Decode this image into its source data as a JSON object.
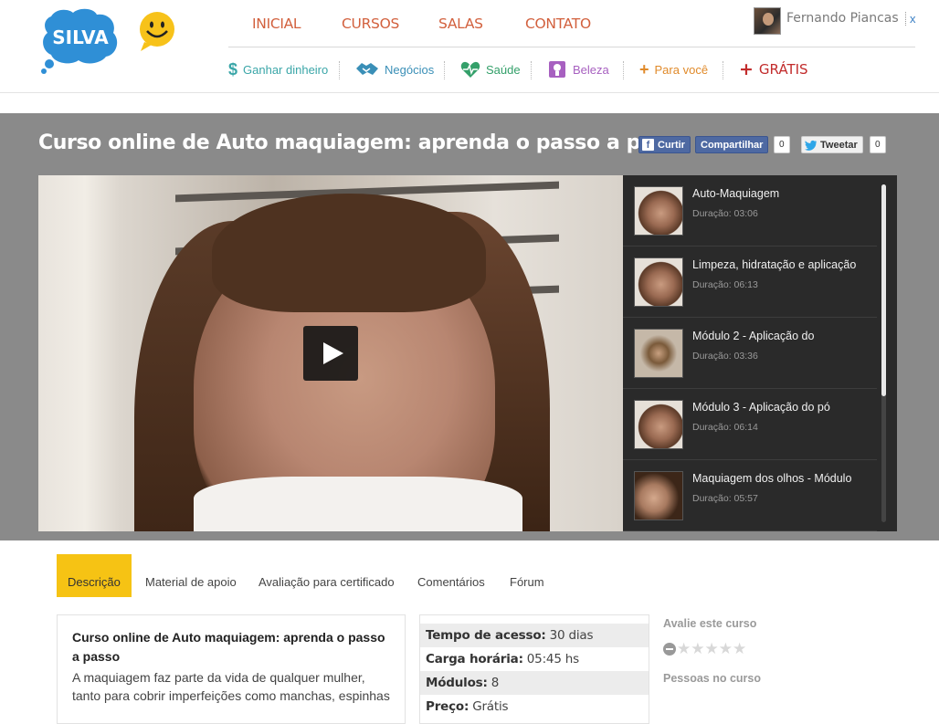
{
  "brand": {
    "logo_text": "SILVA"
  },
  "nav": {
    "main": [
      "INICIAL",
      "CURSOS",
      "SALAS",
      "CONTATO"
    ],
    "sub": [
      {
        "label": "Ganhar dinheiro",
        "icon": "dollar-icon",
        "color": "#3aa6a8"
      },
      {
        "label": "Negócios",
        "icon": "handshake-icon",
        "color": "#3a8fb7"
      },
      {
        "label": "Saúde",
        "icon": "heart-pulse-icon",
        "color": "#34a06a"
      },
      {
        "label": "Beleza",
        "icon": "mirror-icon",
        "color": "#a760c0"
      },
      {
        "label": "Para você",
        "icon": "plus-icon",
        "color": "#e08a2a"
      },
      {
        "label": "GRÁTIS",
        "icon": "plus-icon",
        "color": "#c22c2c"
      }
    ]
  },
  "user": {
    "name": "Fernando Piancas",
    "close": "x"
  },
  "course": {
    "title": "Curso online de Auto maquiagem: aprenda o passo a passo"
  },
  "social": {
    "like_label": "Curtir",
    "share_label": "Compartilhar",
    "share_count": "0",
    "tweet_label": "Tweetar",
    "tweet_count": "0"
  },
  "playlist": [
    {
      "title": "Auto-Maquiagem",
      "duration": "Duração: 03:06"
    },
    {
      "title": "Limpeza, hidratação e aplicação",
      "duration": "Duração: 06:13"
    },
    {
      "title": "Módulo 2 - Aplicação do",
      "duration": "Duração: 03:36"
    },
    {
      "title": "Módulo 3 - Aplicação do pó",
      "duration": "Duração: 06:14"
    },
    {
      "title": "Maquiagem dos olhos - Módulo",
      "duration": "Duração: 05:57"
    }
  ],
  "tabs": [
    "Descrição",
    "Material de apoio",
    "Avaliação para certificado",
    "Comentários",
    "Fórum"
  ],
  "description": {
    "title": "Curso online de Auto maquiagem: aprenda o passo a passo",
    "text": "A maquiagem faz parte da vida de qualquer mulher, tanto para cobrir imperfeições como manchas, espinhas"
  },
  "info": [
    {
      "label": "Tempo de acesso:",
      "value": "30 dias"
    },
    {
      "label": "Carga horária:",
      "value": "05:45 hs"
    },
    {
      "label": "Módulos:",
      "value": "8"
    },
    {
      "label": "Preço:",
      "value": "Grátis"
    }
  ],
  "sidebar": {
    "rate_label": "Avalie este curso",
    "rating": 0,
    "rating_max": 5,
    "people_label": "Pessoas no curso"
  }
}
